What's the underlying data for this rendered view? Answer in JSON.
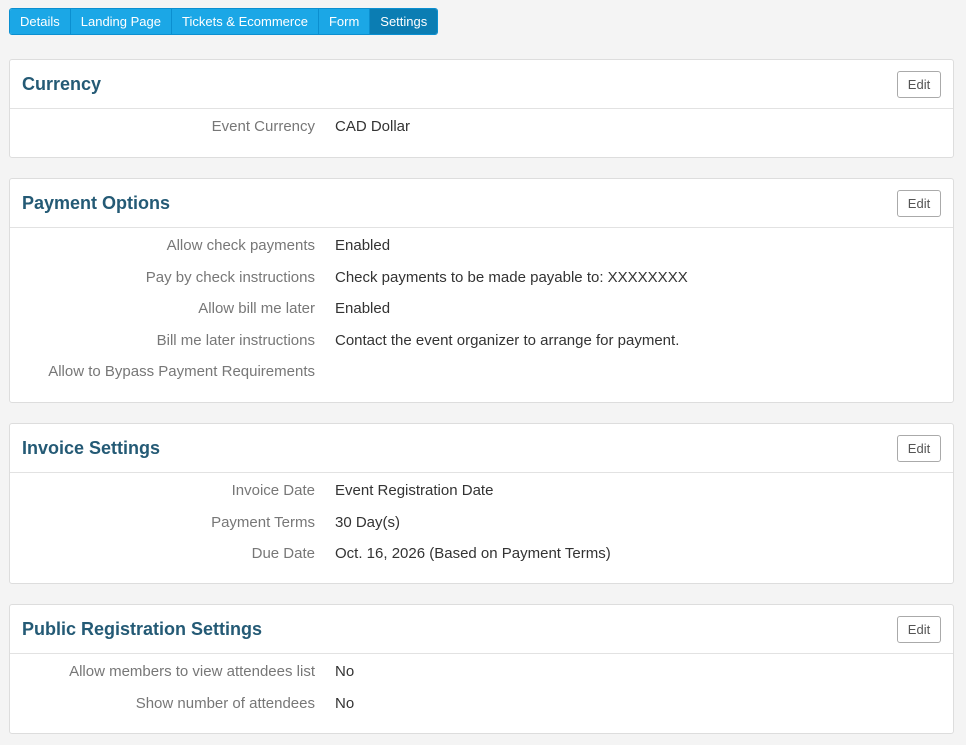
{
  "tabs": [
    {
      "label": "Details"
    },
    {
      "label": "Landing Page"
    },
    {
      "label": "Tickets & Ecommerce"
    },
    {
      "label": "Form"
    },
    {
      "label": "Settings"
    }
  ],
  "active_tab": "Settings",
  "edit_label": "Edit",
  "panels": {
    "currency": {
      "title": "Currency",
      "rows": [
        {
          "label": "Event Currency",
          "value": "CAD Dollar"
        }
      ]
    },
    "payment": {
      "title": "Payment Options",
      "rows": [
        {
          "label": "Allow check payments",
          "value": "Enabled"
        },
        {
          "label": "Pay by check instructions",
          "value": "Check payments to be made payable to: XXXXXXXX"
        },
        {
          "label": "Allow bill me later",
          "value": "Enabled"
        },
        {
          "label": "Bill me later instructions",
          "value": "Contact the event organizer to arrange for payment."
        },
        {
          "label": "Allow to Bypass Payment Requirements",
          "value": ""
        }
      ]
    },
    "invoice": {
      "title": "Invoice Settings",
      "rows": [
        {
          "label": "Invoice Date",
          "value": "Event Registration Date"
        },
        {
          "label": "Payment Terms",
          "value": "30 Day(s)"
        },
        {
          "label": "Due Date",
          "value": "Oct. 16, 2026 (Based on Payment Terms)"
        }
      ]
    },
    "public": {
      "title": "Public Registration Settings",
      "rows": [
        {
          "label": "Allow members to view attendees list",
          "value": "No"
        },
        {
          "label": "Show number of attendees",
          "value": "No"
        }
      ]
    }
  }
}
